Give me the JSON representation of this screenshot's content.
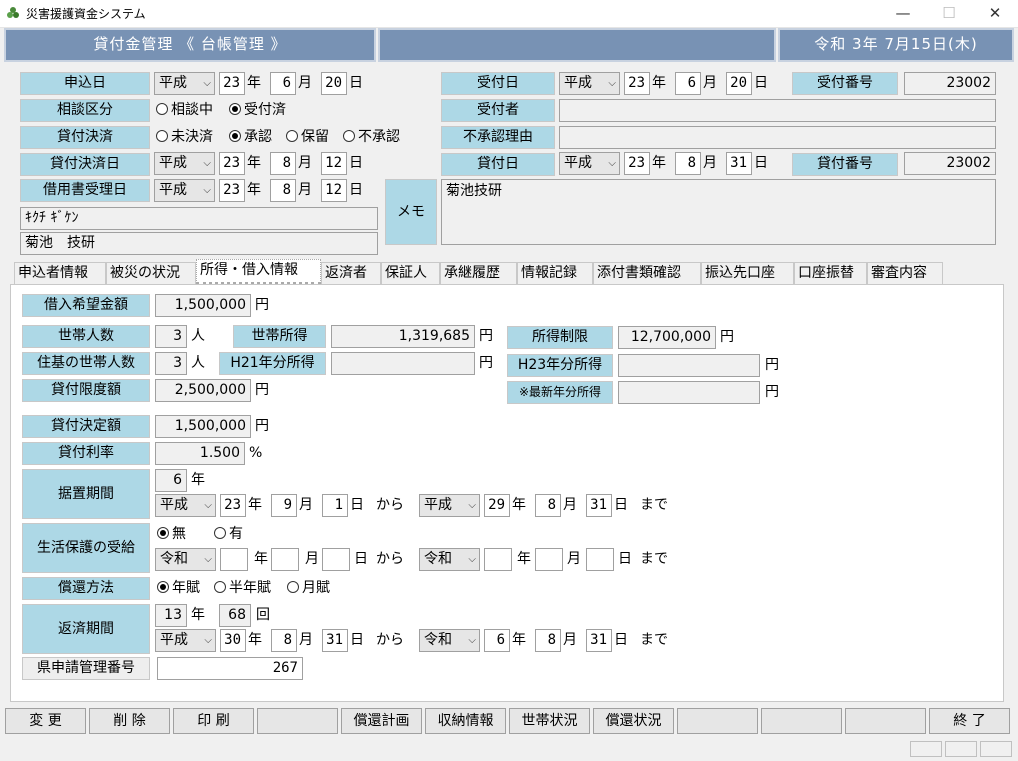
{
  "window": {
    "title": "災害援護資金システム",
    "min": "—",
    "max": "☐",
    "close": "✕"
  },
  "header": {
    "title": "貸付金管理 《 台帳管理 》",
    "date": "令和 3年 7月15日(木)"
  },
  "top": {
    "moushikomi_label": "申込日",
    "moushikomi_era": "平成",
    "moushikomi_y": "23",
    "moushikomi_m": "6",
    "moushikomi_d": "20",
    "soudan_label": "相談区分",
    "soudan_opt1": "相談中",
    "soudan_opt2": "受付済",
    "kettei_label": "貸付決済",
    "kettei_opt1": "未決済",
    "kettei_opt2": "承認",
    "kettei_opt3": "保留",
    "kettei_opt4": "不承認",
    "ketteibi_label": "貸付決済日",
    "ketteibi_era": "平成",
    "ketteibi_y": "23",
    "ketteibi_m": "8",
    "ketteibi_d": "12",
    "shakuyo_label": "借用書受理日",
    "shakuyo_era": "平成",
    "shakuyo_y": "23",
    "shakuyo_m": "8",
    "shakuyo_d": "12",
    "kana": "ｷｸﾁ ｷﾞｹﾝ",
    "name": "菊池　技研",
    "uketsuke_label": "受付日",
    "uketsuke_era": "平成",
    "uketsuke_y": "23",
    "uketsuke_m": "6",
    "uketsuke_d": "20",
    "uketsuke_no_label": "受付番号",
    "uketsuke_no": "23002",
    "uketsukesha_label": "受付者",
    "uketsukesha": "",
    "fushonin_label": "不承認理由",
    "fushonin": "",
    "kashitsuke_label": "貸付日",
    "kashitsuke_era": "平成",
    "kashitsuke_y": "23",
    "kashitsuke_m": "8",
    "kashitsuke_d": "31",
    "kashitsuke_no_label": "貸付番号",
    "kashitsuke_no": "23002",
    "memo_label": "メモ",
    "memo": "菊池技研",
    "y": "年",
    "m": "月",
    "d": "日"
  },
  "tabs": [
    "申込者情報",
    "被災の状況",
    "所得・借入情報",
    "返済者",
    "保証人",
    "承継履歴",
    "情報記録",
    "添付書類確認",
    "振込先口座",
    "口座振替",
    "審査内容"
  ],
  "panel": {
    "kibou_label": "借入希望金額",
    "kibou": "1,500,000",
    "yen": "円",
    "setai_label": "世帯人数",
    "setai": "3",
    "nin": "人",
    "shotoku_label": "世帯所得",
    "shotoku": "1,319,685",
    "seigen_label": "所得制限",
    "seigen": "12,700,000",
    "juuki_label": "住基の世帯人数",
    "juuki": "3",
    "h21_label": "H21年分所得",
    "h21": "",
    "h23_label": "H23年分所得",
    "h23": "",
    "gendo_label": "貸付限度額",
    "gendo": "2,500,000",
    "saishin_label": "※最新年分所得",
    "saishin": "",
    "ketteigaku_label": "貸付決定額",
    "ketteigaku": "1,500,000",
    "riritsu_label": "貸付利率",
    "riritsu": "1.500",
    "pct": "%",
    "sueoki_label": "据置期間",
    "sueoki_nen": "6",
    "sueoki_from_era": "平成",
    "sueoki_from_y": "23",
    "sueoki_from_m": "9",
    "sueoki_from_d": "1",
    "sueoki_to_era": "平成",
    "sueoki_to_y": "29",
    "sueoki_to_m": "8",
    "sueoki_to_d": "31",
    "seikatsu_label": "生活保護の受給",
    "seikatsu_opt1": "無",
    "seikatsu_opt2": "有",
    "seikatsu_from_era": "令和",
    "seikatsu_to_era": "令和",
    "shokan_label": "償還方法",
    "shokan_opt1": "年賦",
    "shokan_opt2": "半年賦",
    "shokan_opt3": "月賦",
    "hensai_label": "返済期間",
    "hensai_nen": "13",
    "hensai_kai": "68",
    "kai": "回",
    "hensai_from_era": "平成",
    "hensai_from_y": "30",
    "hensai_from_m": "8",
    "hensai_from_d": "31",
    "hensai_to_era": "令和",
    "hensai_to_y": "6",
    "hensai_to_m": "8",
    "hensai_to_d": "31",
    "ken_label": "県申請管理番号",
    "ken": "267",
    "kara": "から",
    "made": "まで"
  },
  "buttons": [
    "変 更",
    "削 除",
    "印 刷",
    "",
    "償還計画",
    "収納情報",
    "世帯状況",
    "償還状況",
    "",
    "",
    "",
    "終 了"
  ]
}
